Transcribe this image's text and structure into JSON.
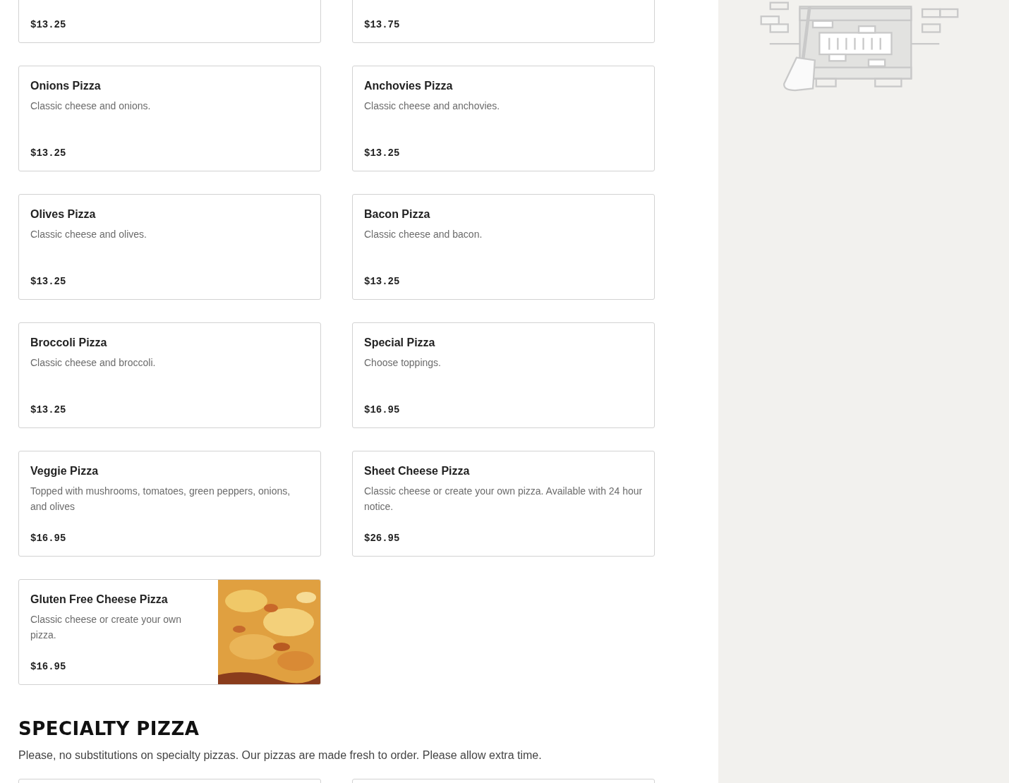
{
  "sections": [
    {
      "items": [
        {
          "kind": "cut",
          "price": "$13.25"
        },
        {
          "kind": "cut",
          "price": "$13.75"
        },
        {
          "kind": "full",
          "name": "Onions Pizza",
          "description": "Classic cheese and onions.",
          "price": "$13.25"
        },
        {
          "kind": "full",
          "name": "Anchovies Pizza",
          "description": "Classic cheese and anchovies.",
          "price": "$13.25"
        },
        {
          "kind": "full",
          "name": "Olives Pizza",
          "description": "Classic cheese and olives.",
          "price": "$13.25"
        },
        {
          "kind": "full",
          "name": "Bacon Pizza",
          "description": "Classic cheese and bacon.",
          "price": "$13.25"
        },
        {
          "kind": "full",
          "name": "Broccoli Pizza",
          "description": "Classic cheese and broccoli.",
          "price": "$13.25"
        },
        {
          "kind": "full",
          "name": "Special Pizza",
          "description": "Choose toppings.",
          "price": "$16.95"
        },
        {
          "kind": "full",
          "name": "Veggie Pizza",
          "description": "Topped with mushrooms, tomatoes, green peppers, onions, and olives",
          "price": "$16.95"
        },
        {
          "kind": "full",
          "name": "Sheet Cheese Pizza",
          "description": "Classic cheese or create your own pizza. Available with 24 hour notice.",
          "price": "$26.95"
        },
        {
          "name": "Gluten Free Cheese Pizza",
          "description": "Classic cheese or create your own pizza.",
          "price": "$16.95"
        }
      ]
    },
    {
      "title": "SPECIALTY PIZZA",
      "note": "Please, no substitutions on specialty pizzas. Our pizzas are made fresh to order. Please allow extra time.",
      "items": [
        {
          "kind": "empty"
        },
        {
          "kind": "empty"
        }
      ]
    }
  ]
}
